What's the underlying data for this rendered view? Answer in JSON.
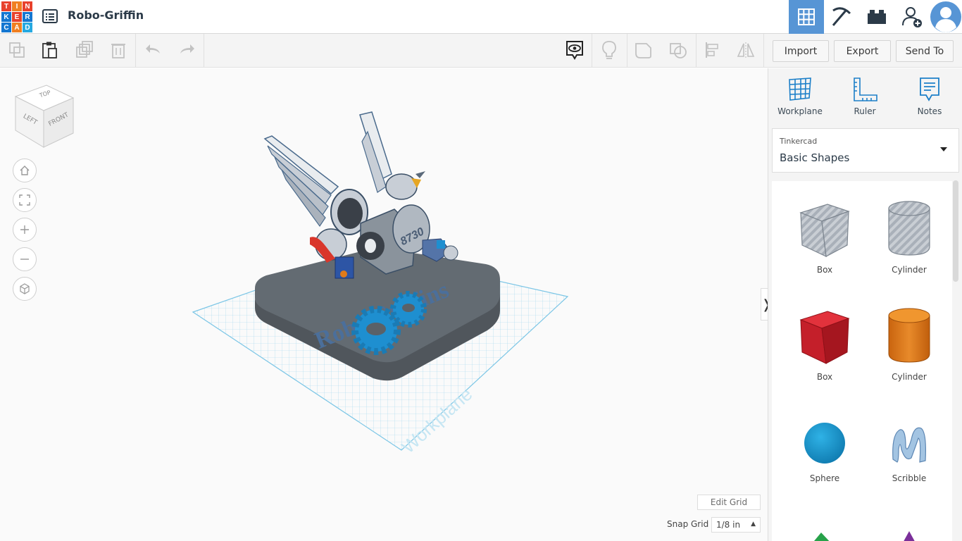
{
  "app": {
    "logo_letters": [
      "T",
      "I",
      "N",
      "K",
      "E",
      "R",
      "C",
      "A",
      "D"
    ],
    "logo_colors": [
      "#e8412c",
      "#f07f21",
      "#e8412c",
      "#1477d1",
      "#e8412c",
      "#1477d1",
      "#1477d1",
      "#f07f21",
      "#26a9e1"
    ],
    "title": "Robo-Griffin"
  },
  "toolbar": {
    "import_label": "Import",
    "export_label": "Export",
    "send_to_label": "Send To"
  },
  "viewcube": {
    "top": "TOP",
    "left": "LEFT",
    "front": "FRONT"
  },
  "viewport": {
    "model_text": "Robo Griffins",
    "model_number": "8730",
    "workplane_label": "Workplane",
    "edit_grid_label": "Edit Grid",
    "snap_grid_label": "Snap Grid",
    "snap_grid_value": "1/8 in"
  },
  "panel": {
    "tools": [
      {
        "label": "Workplane",
        "icon": "workplane-icon"
      },
      {
        "label": "Ruler",
        "icon": "ruler-icon"
      },
      {
        "label": "Notes",
        "icon": "notes-icon"
      }
    ],
    "library_source": "Tinkercad",
    "library_name": "Basic Shapes",
    "shapes": [
      {
        "label": "Box",
        "color": "#b5bcc6"
      },
      {
        "label": "Cylinder",
        "color": "#b5bcc6"
      },
      {
        "label": "Box",
        "color": "#d0212f"
      },
      {
        "label": "Cylinder",
        "color": "#e07b1a"
      },
      {
        "label": "Sphere",
        "color": "#1693c9"
      },
      {
        "label": "Scribble",
        "color": "#8fb4d8"
      }
    ]
  },
  "colors": {
    "accent": "#5795d5",
    "workplane_blue": "#8fd3ef",
    "base_gray": "#5a6168"
  }
}
